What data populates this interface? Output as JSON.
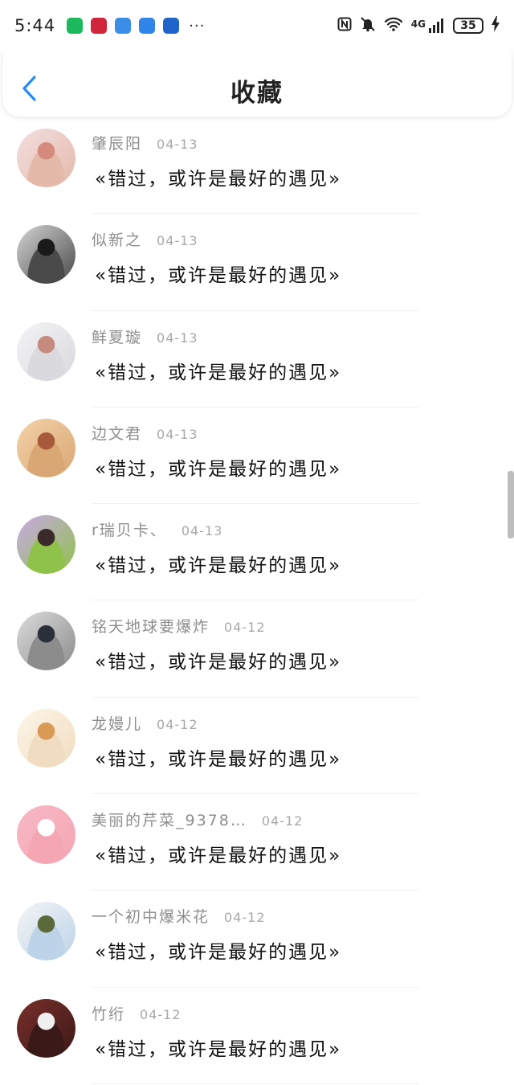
{
  "status_bar": {
    "time": "5:44",
    "more": "···",
    "network": "4G",
    "battery": "35",
    "app_icons": [
      {
        "name": "green-app-icon",
        "color": "#1bb85c"
      },
      {
        "name": "huawei-app-icon",
        "color": "#d0253a"
      },
      {
        "name": "chat-app-icon",
        "color": "#3a8ee6"
      },
      {
        "name": "cloud-app-icon",
        "color": "#2f86e8"
      },
      {
        "name": "pay-app-icon",
        "color": "#1f64c8"
      }
    ]
  },
  "header": {
    "title": "收藏"
  },
  "accent_color": "#2a8bf2",
  "items": [
    {
      "name": "肇辰阳",
      "date": "04-13",
      "content": "«错过，或许是最好的遇见»",
      "avatar": {
        "a": "#f3dfe0",
        "b": "#e3b9a9",
        "c": "#d48a7c"
      }
    },
    {
      "name": "似新之",
      "date": "04-13",
      "content": "«错过，或许是最好的遇见»",
      "avatar": {
        "a": "#d4d4d4",
        "b": "#4a4a4a",
        "c": "#1a1a1a"
      }
    },
    {
      "name": "鲜夏璇",
      "date": "04-13",
      "content": "«错过，或许是最好的遇见»",
      "avatar": {
        "a": "#f4f4f6",
        "b": "#d9d9de",
        "c": "#c78a7e"
      }
    },
    {
      "name": "边文君",
      "date": "04-13",
      "content": "«错过，或许是最好的遇见»",
      "avatar": {
        "a": "#f3d2a8",
        "b": "#d9a773",
        "c": "#a65a3a"
      }
    },
    {
      "name": "r瑞贝卡、",
      "date": "04-13",
      "content": "«错过，或许是最好的遇见»",
      "avatar": {
        "a": "#c9a9e6",
        "b": "#8fc24a",
        "c": "#3a2a2a"
      }
    },
    {
      "name": "铭天地球要爆炸",
      "date": "04-12",
      "content": "«错过，或许是最好的遇见»",
      "avatar": {
        "a": "#dcdcdc",
        "b": "#8c8c8c",
        "c": "#2a2f3a"
      }
    },
    {
      "name": "龙嫚儿",
      "date": "04-12",
      "content": "«错过，或许是最好的遇见»",
      "avatar": {
        "a": "#fdf6e8",
        "b": "#f0dcc0",
        "c": "#d99a55"
      }
    },
    {
      "name": "美丽的芹菜_9378…",
      "date": "04-12",
      "content": "«错过，或许是最好的遇见»",
      "avatar": {
        "a": "#f7b9c4",
        "b": "#f4a6b4",
        "c": "#ffffff"
      }
    },
    {
      "name": "一个初中爆米花",
      "date": "04-12",
      "content": "«错过，或许是最好的遇见»",
      "avatar": {
        "a": "#f5f5f5",
        "b": "#bcd3e8",
        "c": "#5a6a3a"
      }
    },
    {
      "name": "竹绗",
      "date": "04-12",
      "content": "«错过，或许是最好的遇见»",
      "avatar": {
        "a": "#7a2f2a",
        "b": "#3a1a18",
        "c": "#f0f0f0"
      }
    }
  ]
}
